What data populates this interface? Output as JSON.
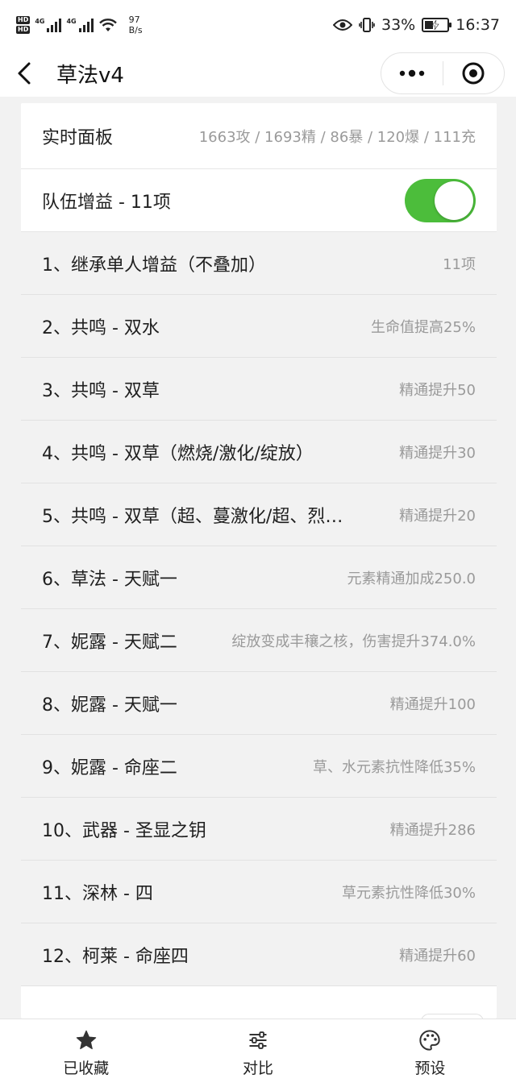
{
  "status_bar": {
    "hd1": "HD",
    "hd2": "HD",
    "net1": "4G",
    "net2": "4G",
    "speed_value": "97",
    "speed_unit": "B/s",
    "battery": "33%",
    "time": "16:37",
    "icons": [
      "hd-icon",
      "signal-icon",
      "wifi-icon",
      "eye-icon",
      "vibrate-icon",
      "battery-icon"
    ]
  },
  "nav": {
    "title": "草法v4",
    "icons": [
      "back-arrow-icon",
      "more-dots-icon",
      "target-icon"
    ]
  },
  "panel": {
    "label": "实时面板",
    "stats": "1663攻 / 1693精 / 86暴 / 120爆 / 111充"
  },
  "team_buff": {
    "label": "队伍增益 - 11项",
    "enabled": true,
    "toggle_color": "#4cbd3b"
  },
  "items": [
    {
      "label": "1、继承单人增益（不叠加）",
      "value": "11项"
    },
    {
      "label": "2、共鸣 - 双水",
      "value": "生命值提高25%"
    },
    {
      "label": "3、共鸣 - 双草",
      "value": "精通提升50"
    },
    {
      "label": "4、共鸣 - 双草（燃烧/激化/绽放）",
      "value": "精通提升30"
    },
    {
      "label": "5、共鸣 - 双草（超、蔓激化/超、烈…",
      "value": "精通提升20"
    },
    {
      "label": "6、草法 - 天赋一",
      "value": "元素精通加成250.0"
    },
    {
      "label": "7、妮露 - 天赋二",
      "value": "绽放变成丰穰之核，伤害提升374.0%"
    },
    {
      "label": "8、妮露 - 天赋一",
      "value": "精通提升100"
    },
    {
      "label": "9、妮露 - 命座二",
      "value": "草、水元素抗性降低35%"
    },
    {
      "label": "10、武器 - 圣显之钥",
      "value": "精通提升286"
    },
    {
      "label": "11、深林 - 四",
      "value": "草元素抗性降低30%"
    },
    {
      "label": "12、柯莱 - 命座四",
      "value": "精通提升60"
    }
  ],
  "tabs": [
    {
      "label": "已收藏",
      "icon": "star-icon"
    },
    {
      "label": "对比",
      "icon": "sliders-icon"
    },
    {
      "label": "预设",
      "icon": "palette-icon"
    }
  ]
}
